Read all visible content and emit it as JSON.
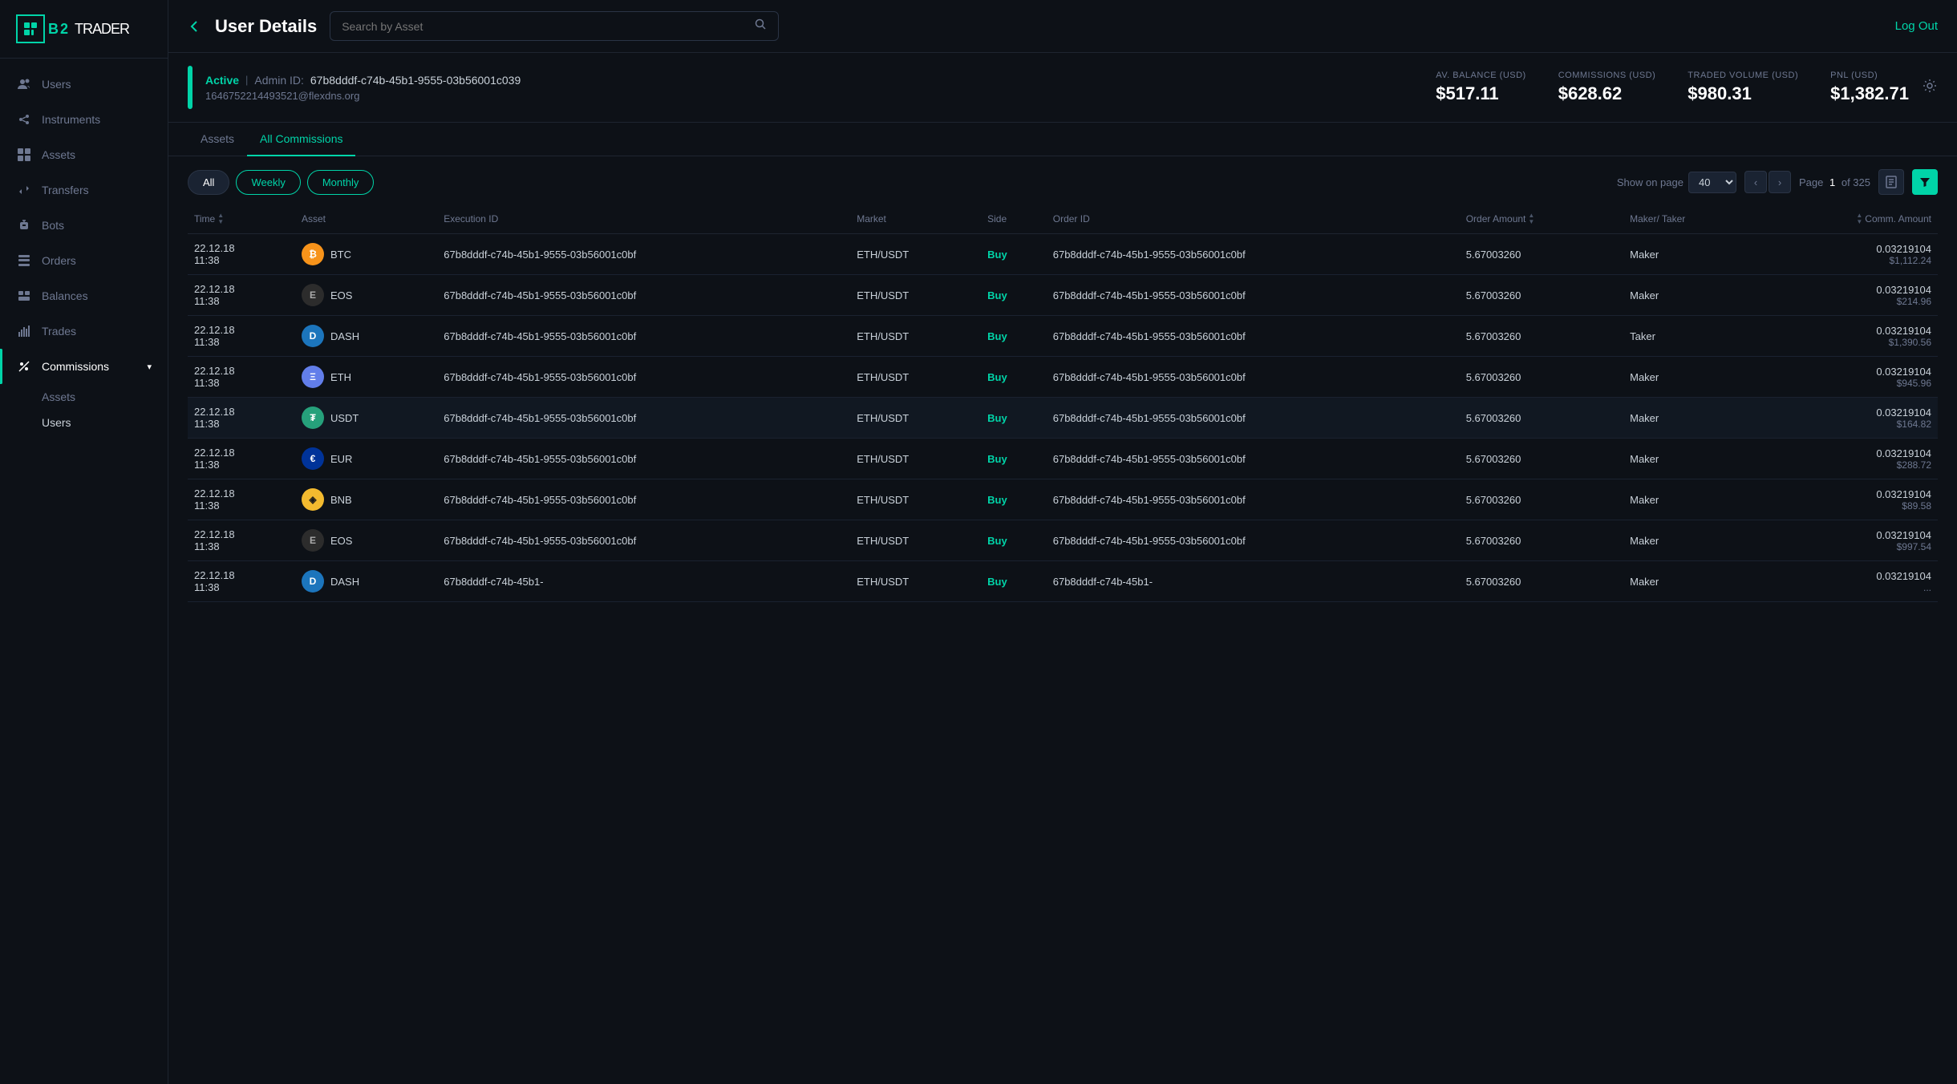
{
  "app": {
    "logo_b2": "B2",
    "logo_trader": "TRADER",
    "logout_label": "Log Out"
  },
  "sidebar": {
    "items": [
      {
        "id": "users",
        "label": "Users",
        "icon": "👤"
      },
      {
        "id": "instruments",
        "label": "Instruments",
        "icon": "🔧"
      },
      {
        "id": "assets",
        "label": "Assets",
        "icon": "📦"
      },
      {
        "id": "transfers",
        "label": "Transfers",
        "icon": "↔️"
      },
      {
        "id": "bots",
        "label": "Bots",
        "icon": "🤖"
      },
      {
        "id": "orders",
        "label": "Orders",
        "icon": "📋"
      },
      {
        "id": "balances",
        "label": "Balances",
        "icon": "⊞"
      },
      {
        "id": "trades",
        "label": "Trades",
        "icon": "📊"
      },
      {
        "id": "commissions",
        "label": "Commissions",
        "icon": "💰",
        "active": true
      }
    ],
    "commission_sub": [
      {
        "id": "assets",
        "label": "Assets"
      },
      {
        "id": "users",
        "label": "Users"
      }
    ]
  },
  "header": {
    "back_label": "‹",
    "title": "User Details",
    "search_placeholder": "Search by Asset",
    "search_icon": "🔍"
  },
  "user": {
    "status": "Active",
    "separator": "|",
    "admin_prefix": "Admin ID:",
    "admin_id": "67b8dddf-c74b-45b1-9555-03b56001c039",
    "email": "1646752214493521@flexdns.org"
  },
  "stats": {
    "av_balance_label": "Av. Balance (USD)",
    "av_balance_value": "$517.11",
    "commissions_label": "Commissions (USD)",
    "commissions_value": "$628.62",
    "traded_volume_label": "Traded Volume (USD)",
    "traded_volume_value": "$980.31",
    "pnl_label": "PnL (USD)",
    "pnl_value": "$1,382.71"
  },
  "tabs": [
    {
      "id": "assets",
      "label": "Assets",
      "active": false
    },
    {
      "id": "all_commissions",
      "label": "All Commissions",
      "active": true
    }
  ],
  "filters": {
    "all_label": "All",
    "weekly_label": "Weekly",
    "monthly_label": "Monthly"
  },
  "pagination": {
    "show_on_page_label": "Show on page",
    "page_size": "40",
    "page_label": "Page",
    "current_page": "1",
    "total_pages": "of 325"
  },
  "table": {
    "columns": [
      {
        "id": "time",
        "label": "Time"
      },
      {
        "id": "asset",
        "label": "Asset"
      },
      {
        "id": "execution_id",
        "label": "Execution ID"
      },
      {
        "id": "market",
        "label": "Market"
      },
      {
        "id": "side",
        "label": "Side"
      },
      {
        "id": "order_id",
        "label": "Order ID"
      },
      {
        "id": "order_amount",
        "label": "Order Amount"
      },
      {
        "id": "maker_taker",
        "label": "Maker/ Taker"
      },
      {
        "id": "comm_amount",
        "label": "Comm. Amount"
      }
    ],
    "rows": [
      {
        "time": "22.12.18 11:38",
        "asset": "BTC",
        "asset_type": "btc",
        "execution_id": "67b8dddf-c74b-45b1-9555-03b56001c0bf",
        "market": "ETH/USDT",
        "side": "Buy",
        "order_id": "67b8dddf-c74b-45b1-9555-03b56001c0bf",
        "order_amount": "5.67003260",
        "maker_taker": "Maker",
        "comm_amount": "0.03219104",
        "comm_usd": "$1,112.24"
      },
      {
        "time": "22.12.18 11:38",
        "asset": "EOS",
        "asset_type": "eos",
        "execution_id": "67b8dddf-c74b-45b1-9555-03b56001c0bf",
        "market": "ETH/USDT",
        "side": "Buy",
        "order_id": "67b8dddf-c74b-45b1-9555-03b56001c0bf",
        "order_amount": "5.67003260",
        "maker_taker": "Maker",
        "comm_amount": "0.03219104",
        "comm_usd": "$214.96"
      },
      {
        "time": "22.12.18 11:38",
        "asset": "DASH",
        "asset_type": "dash",
        "execution_id": "67b8dddf-c74b-45b1-9555-03b56001c0bf",
        "market": "ETH/USDT",
        "side": "Buy",
        "order_id": "67b8dddf-c74b-45b1-9555-03b56001c0bf",
        "order_amount": "5.67003260",
        "maker_taker": "Taker",
        "comm_amount": "0.03219104",
        "comm_usd": "$1,390.56"
      },
      {
        "time": "22.12.18 11:38",
        "asset": "ETH",
        "asset_type": "eth",
        "execution_id": "67b8dddf-c74b-45b1-9555-03b56001c0bf",
        "market": "ETH/USDT",
        "side": "Buy",
        "order_id": "67b8dddf-c74b-45b1-9555-03b56001c0bf",
        "order_amount": "5.67003260",
        "maker_taker": "Maker",
        "comm_amount": "0.03219104",
        "comm_usd": "$945.96"
      },
      {
        "time": "22.12.18 11:38",
        "asset": "USDT",
        "asset_type": "usdt",
        "execution_id": "67b8dddf-c74b-45b1-9555-03b56001c0bf",
        "market": "ETH/USDT",
        "side": "Buy",
        "order_id": "67b8dddf-c74b-45b1-9555-03b56001c0bf",
        "order_amount": "5.67003260",
        "maker_taker": "Maker",
        "comm_amount": "0.03219104",
        "comm_usd": "$164.82"
      },
      {
        "time": "22.12.18 11:38",
        "asset": "EUR",
        "asset_type": "eur",
        "execution_id": "67b8dddf-c74b-45b1-9555-03b56001c0bf",
        "market": "ETH/USDT",
        "side": "Buy",
        "order_id": "67b8dddf-c74b-45b1-9555-03b56001c0bf",
        "order_amount": "5.67003260",
        "maker_taker": "Maker",
        "comm_amount": "0.03219104",
        "comm_usd": "$288.72"
      },
      {
        "time": "22.12.18 11:38",
        "asset": "BNB",
        "asset_type": "bnb",
        "execution_id": "67b8dddf-c74b-45b1-9555-03b56001c0bf",
        "market": "ETH/USDT",
        "side": "Buy",
        "order_id": "67b8dddf-c74b-45b1-9555-03b56001c0bf",
        "order_amount": "5.67003260",
        "maker_taker": "Maker",
        "comm_amount": "0.03219104",
        "comm_usd": "$89.58"
      },
      {
        "time": "22.12.18 11:38",
        "asset": "EOS",
        "asset_type": "eos",
        "execution_id": "67b8dddf-c74b-45b1-9555-03b56001c0bf",
        "market": "ETH/USDT",
        "side": "Buy",
        "order_id": "67b8dddf-c74b-45b1-9555-03b56001c0bf",
        "order_amount": "5.67003260",
        "maker_taker": "Maker",
        "comm_amount": "0.03219104",
        "comm_usd": "$997.54"
      },
      {
        "time": "22.12.18 11:38",
        "asset": "DASH",
        "asset_type": "dash",
        "execution_id": "67b8dddf-c74b-45b1-",
        "market": "ETH/USDT",
        "side": "Buy",
        "order_id": "67b8dddf-c74b-45b1-",
        "order_amount": "5.67003260",
        "maker_taker": "Maker",
        "comm_amount": "0.03219104",
        "comm_usd": "..."
      }
    ]
  }
}
